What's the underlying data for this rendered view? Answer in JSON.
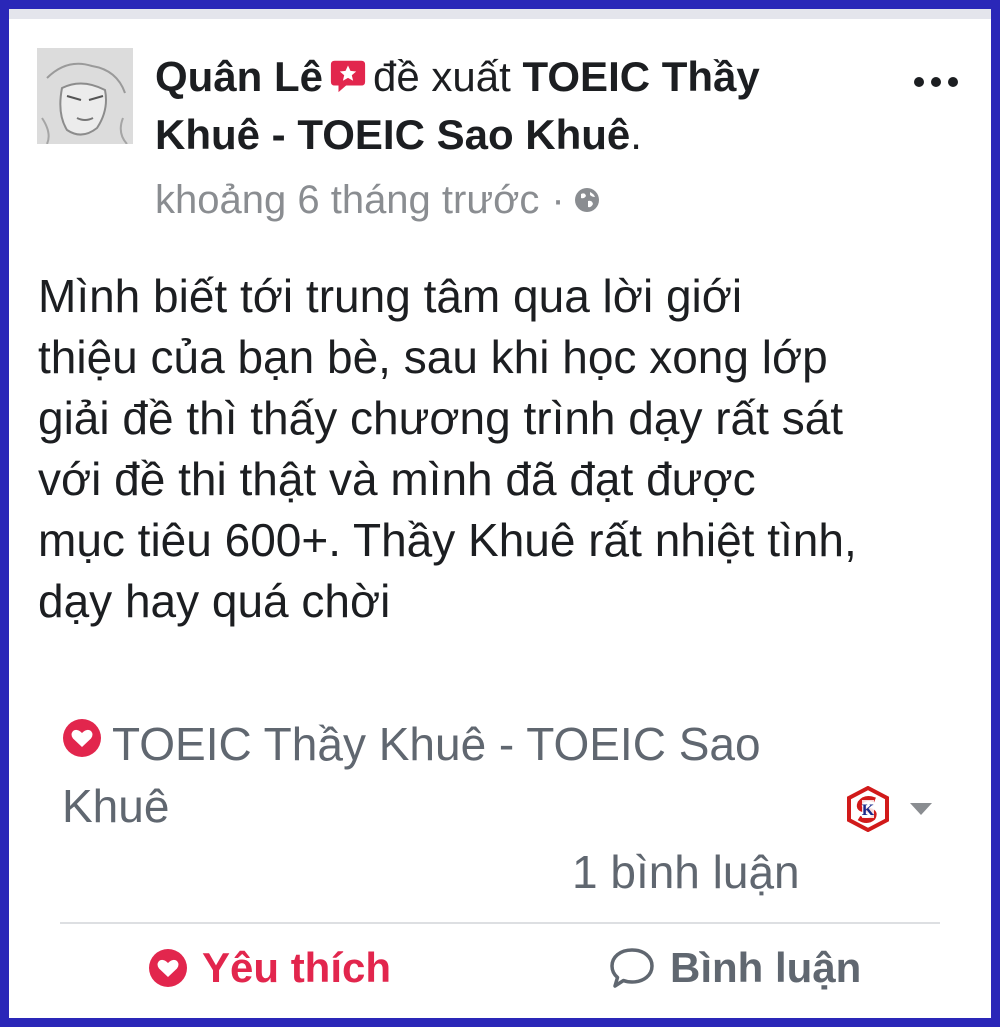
{
  "post": {
    "author": "Quân Lê",
    "recommends_text": "đề xuất",
    "page_name": "TOEIC Thầy Khuê - TOEIC Sao Khuê",
    "period": ".",
    "timestamp": "khoảng 6 tháng trước",
    "separator": "·",
    "review_text": "Mình biết tới trung tâm qua lời giới\nthiệu của bạn bè, sau khi học xong lớp\ngiải đề thì thấy chương trình dạy rất sát\nvới đề thi thật và mình đã đạt được\nmục tiêu 600+. Thầy Khuê rất nhiệt tình,\ndạy hay quá chời"
  },
  "footer": {
    "page_ref": "TOEIC Thầy Khuê - TOEIC Sao Khuê",
    "comment_count": "1 bình luận",
    "like_label": "Yêu thích",
    "comment_label": "Bình luận"
  },
  "icons": {
    "recommend": "recommend-icon",
    "more": "more-icon",
    "globe": "globe-icon",
    "heart": "heart-icon",
    "dropdown": "chevron-down-icon",
    "comment": "comment-icon"
  },
  "colors": {
    "frame": "#2a27b8",
    "like": "#e2264d",
    "text": "#1c1e21",
    "muted": "#606770"
  }
}
